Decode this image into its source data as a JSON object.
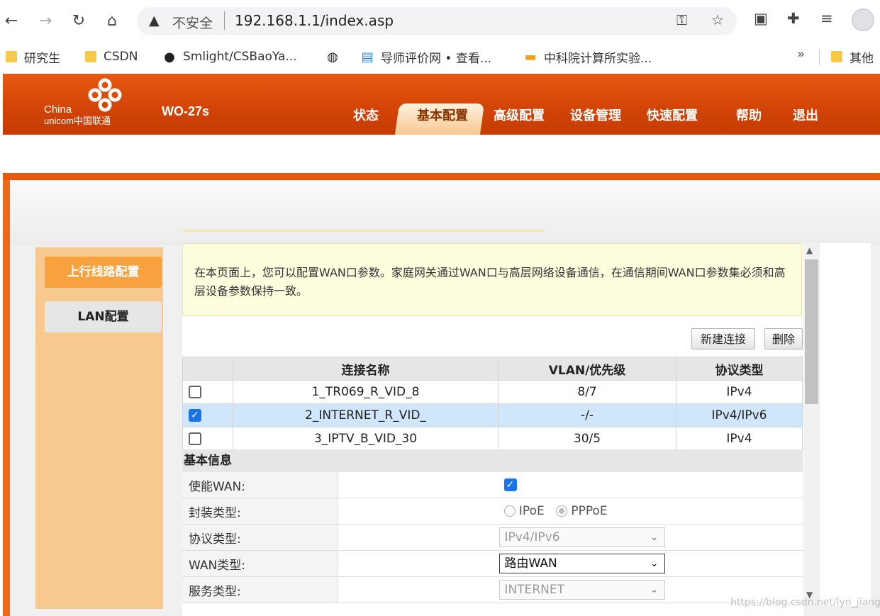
{
  "browser": {
    "security_label": "不安全",
    "url": "192.168.1.1/index.asp",
    "bookmarks": [
      {
        "label": "研究生",
        "icon": "folder-icon"
      },
      {
        "label": "CSDN",
        "icon": "folder-icon"
      },
      {
        "label": "Smlight/CSBaoYa...",
        "icon": "github-icon"
      },
      {
        "label": "",
        "icon": "globe-icon"
      },
      {
        "label": "导师评价网 • 查看...",
        "icon": "site-icon"
      },
      {
        "label": "中科院计算所实验...",
        "icon": "site-icon"
      }
    ],
    "more_label": "»",
    "other_label": "其他"
  },
  "router": {
    "logo_line1": "China",
    "logo_line2": "unicom中国联通",
    "model": "WO-27s",
    "menu": [
      "状态",
      "基本配置",
      "高级配置",
      "设备管理",
      "快速配置",
      "帮助",
      "退出"
    ],
    "active_menu": "基本配置"
  },
  "sidebar": {
    "items": [
      {
        "label": "上行线路配置",
        "active": true
      },
      {
        "label": "LAN配置",
        "active": false
      }
    ]
  },
  "notice": "在本页面上，您可以配置WAN口参数。家庭网关通过WAN口与高层网络设备通信，在通信期间WAN口参数集必须和高层设备参数保持一致。",
  "buttons": {
    "new_connection": "新建连接",
    "delete": "删除"
  },
  "wan_table": {
    "headers": [
      "",
      "连接名称",
      "VLAN/优先级",
      "协议类型"
    ],
    "rows": [
      {
        "checked": false,
        "name": "1_TR069_R_VID_8",
        "vlan": "8/7",
        "protocol": "IPv4"
      },
      {
        "checked": true,
        "name": "2_INTERNET_R_VID_",
        "vlan": "-/-",
        "protocol": "IPv4/IPv6"
      },
      {
        "checked": false,
        "name": "3_IPTV_B_VID_30",
        "vlan": "30/5",
        "protocol": "IPv4"
      }
    ]
  },
  "basic_info": {
    "title": "基本信息",
    "enable_wan_label": "使能WAN:",
    "enable_wan_checked": true,
    "encap_label": "封装类型:",
    "encap_options": [
      "IPoE",
      "PPPoE"
    ],
    "encap_selected": "PPPoE",
    "protocol_label": "协议类型:",
    "protocol_value": "IPv4/IPv6",
    "wan_type_label": "WAN类型:",
    "wan_type_value": "路由WAN",
    "service_label": "服务类型:",
    "service_value": "INTERNET"
  },
  "watermark": "https://blog.csdn.net/lyn_jiang",
  "colors": {
    "brand_orange": "#d14306",
    "sidebar_active": "#f8a23f",
    "selected_row": "#cfe6fb",
    "notice_bg": "#fefedf"
  }
}
